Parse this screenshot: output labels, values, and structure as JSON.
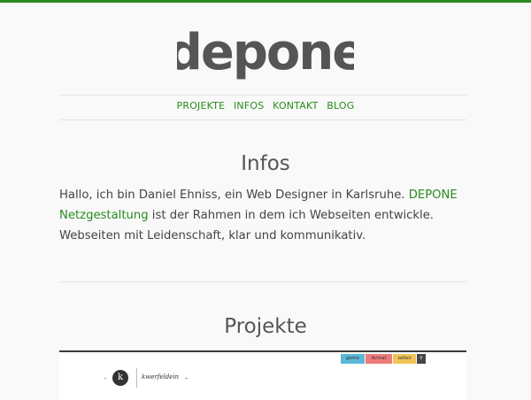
{
  "logo": {
    "text": "depone",
    "color": "#555555"
  },
  "nav": {
    "items": [
      {
        "label": "PROJEKTE"
      },
      {
        "label": "INFOS"
      },
      {
        "label": "KONTAKT"
      },
      {
        "label": "BLOG"
      }
    ]
  },
  "infos": {
    "heading": "Infos",
    "text_before": "Hallo, ich bin Daniel Ehniss, ein Web Designer in Karlsruhe. ",
    "link": "DEPONE Netzgestaltung",
    "text_after": " ist der Rahmen in dem ich Webseiten entwickle. Webseiten mit Leidenschaft, klar und kommunikativ."
  },
  "projekte": {
    "heading": "Projekte",
    "preview": {
      "tabs": [
        "genre",
        "format",
        "selten"
      ],
      "site_name": "kwerfeldein",
      "logo_letter": "k"
    }
  },
  "colors": {
    "accent": "#2a8a1e",
    "text": "#444444",
    "background": "#f9f9f9"
  }
}
